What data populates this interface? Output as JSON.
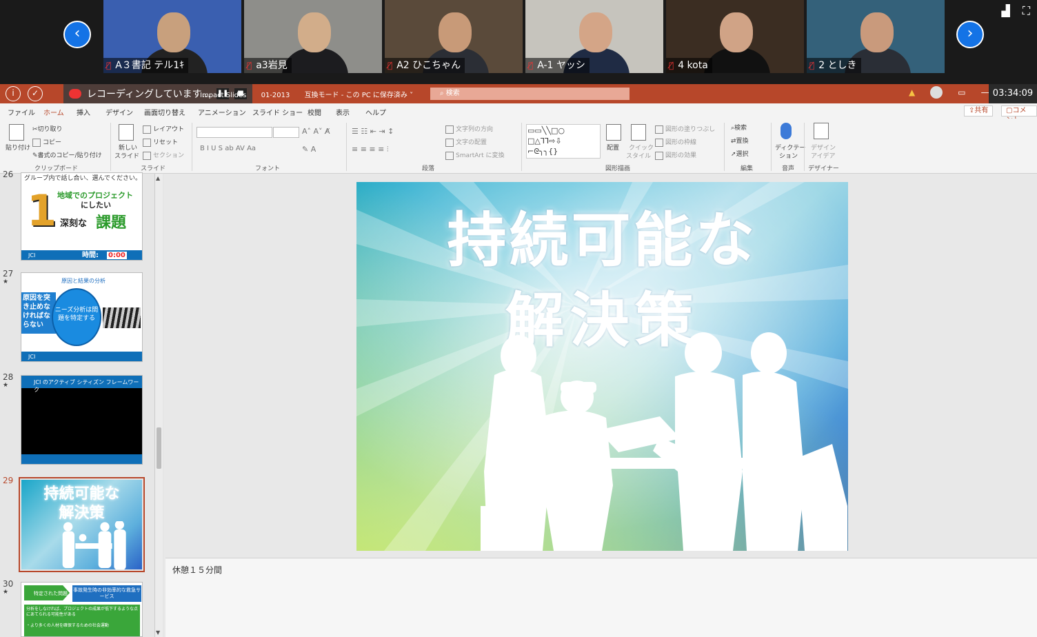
{
  "video": {
    "participants": [
      {
        "name": "A３書記 テル1ｷ",
        "bg": "#3a5fb0",
        "face": "#c8a07d",
        "shirt": "#222222"
      },
      {
        "name": "a3岩見",
        "bg": "#8e8e8a",
        "face": "#d2ad8a",
        "shirt": "#1c1c1f"
      },
      {
        "name": "A2 ひこちゃん",
        "bg": "#5a4a3a",
        "face": "#c89a78",
        "shirt": "#2b2e35"
      },
      {
        "name": "A-1 ヤッシ",
        "bg": "#c6c4bd",
        "face": "#d4a587",
        "shirt": "#1f2b44"
      },
      {
        "name": "4 kota",
        "bg": "#3b2d22",
        "face": "#d0a386",
        "shirt": "#111111"
      },
      {
        "name": "2 としき",
        "bg": "#34617a",
        "face": "#c99a7c",
        "shirt": "#2a2e36"
      }
    ],
    "prev_icon": "chevron-left-icon",
    "next_icon": "chevron-right-icon"
  },
  "titlebar": {
    "recording_text": "レコーディングしています...",
    "doc_title_a": "Impact Slides",
    "doc_title_b": "01-2013",
    "doc_mode": "互換モード - この PC に保存済み ˅",
    "search_placeholder": "検索",
    "timer": "03:34:09",
    "accent": "#b7472a"
  },
  "menu": {
    "tabs": [
      "ファイル",
      "ホーム",
      "挿入",
      "デザイン",
      "画面切り替え",
      "アニメーション",
      "スライド ショー",
      "校閲",
      "表示",
      "ヘルプ"
    ],
    "active_tab": "ホーム",
    "share": "共有",
    "comment": "コメント"
  },
  "ribbon": {
    "paste": "貼り付け",
    "cut": "切り取り",
    "copy": "コピー",
    "format_painter": "書式のコピー/貼り付け",
    "clipboard": "クリップボード",
    "new_slide_1": "新しい",
    "new_slide_2": "スライド",
    "layout": "レイアウト",
    "reset": "リセット",
    "section": "セクション",
    "slides": "スライド",
    "font": "フォント",
    "text_direction": "文字列の方向",
    "text_align": "文字の配置",
    "smartart": "SmartArt に変換",
    "paragraph": "段落",
    "arrange": "配置",
    "quick_styles_1": "クイック",
    "quick_styles_2": "スタイル",
    "shape_fill": "図形の塗りつぶし",
    "shape_outline": "図形の枠線",
    "shape_effects": "図形の効果",
    "drawing": "図形描画",
    "find": "検索",
    "replace": "置換",
    "select": "選択",
    "editing": "編集",
    "dictate_1": "ディクテー",
    "dictate_2": "ション",
    "voice": "音声",
    "design_ideas_1": "デザイン",
    "design_ideas_2": "アイデア",
    "designer": "デザイナー"
  },
  "thumbs": {
    "top_num": "26",
    "slide26": {
      "caption": "グループ内で話し合い、選んでください。",
      "num_big": "1",
      "line1": "地域でのプロジェクト",
      "line2": "にしたい",
      "line3a": "深刻な",
      "line3b": "課題",
      "footer": "JCI",
      "time_label": "時間:",
      "time_val": "0:00"
    },
    "slide27": {
      "num": "27",
      "heading": "原因と結果の分析",
      "left_text": "原因を突き止めなければならない",
      "bubble": "ニーズ分析は問題を特定する",
      "footer": "JCI"
    },
    "slide28": {
      "num": "28",
      "heading": "JCI のアクティブ シティズン フレームワーク"
    },
    "slide29": {
      "num": "29",
      "line1": "持続可能な",
      "line2": "解決策"
    },
    "slide30": {
      "num": "30",
      "arrow": "特定された問題",
      "box": "事故発生時の非効率的な救急サービス",
      "text1": "分析をしなければ、プロジェクトの成果が低下するような点にあてられる可能性がある",
      "text2": "・より多くの人材を確保するための社会運動"
    }
  },
  "slide": {
    "title_line1": "持続可能な",
    "title_line2": "解決策"
  },
  "notes": {
    "text": "休憩１５分間"
  }
}
